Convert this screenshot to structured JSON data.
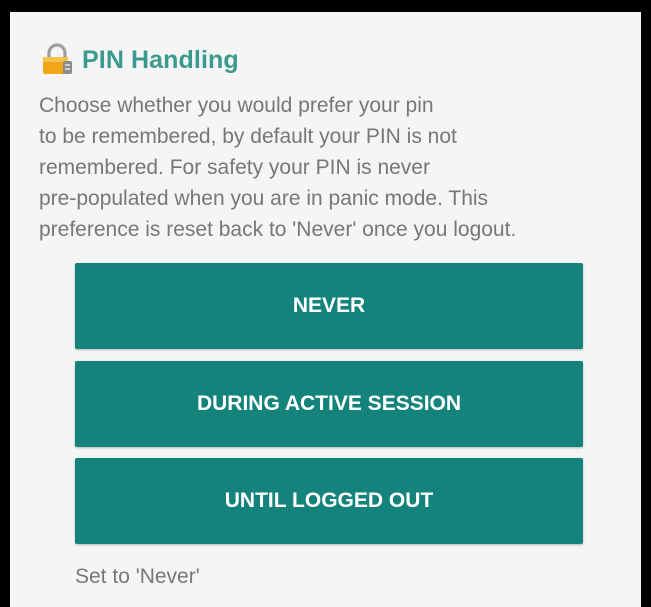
{
  "pin_handling": {
    "icon": "lock-icon",
    "title": "PIN Handling",
    "description": "Choose whether you would prefer your pin\nto be remembered, by default your PIN is not\nremembered. For safety your PIN is never\npre-populated when you are in panic mode.  This\npreference is reset back to 'Never' once you logout.",
    "options": [
      {
        "label": "NEVER"
      },
      {
        "label": "DURING ACTIVE SESSION"
      },
      {
        "label": "UNTIL LOGGED OUT"
      }
    ],
    "status": "Set to 'Never'"
  },
  "colors": {
    "accent_title": "#3a9a8e",
    "button_bg": "#13837b",
    "button_text": "#ffffff",
    "body_text": "#777777",
    "panel_bg": "#f5f5f5",
    "frame": "#000000"
  }
}
